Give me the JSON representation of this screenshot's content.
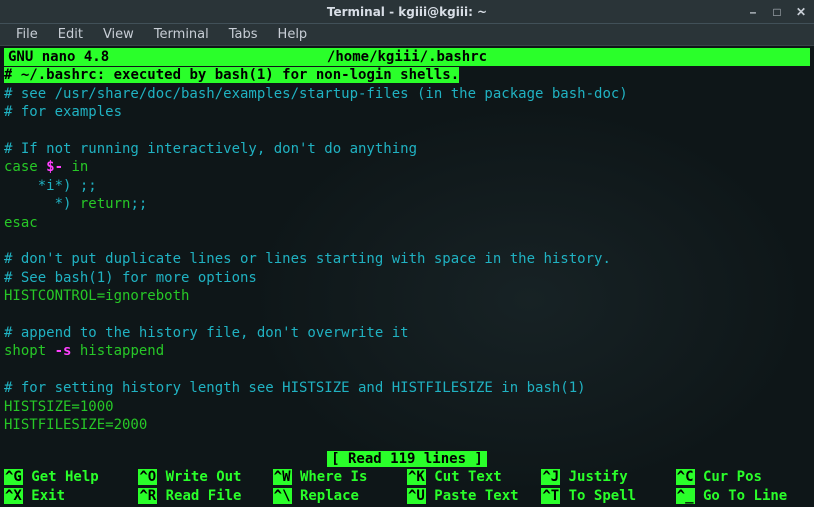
{
  "window": {
    "title": "Terminal - kgiii@kgiii: ~"
  },
  "menubar": {
    "items": [
      "File",
      "Edit",
      "View",
      "Terminal",
      "Tabs",
      "Help"
    ]
  },
  "nano": {
    "app_version": "GNU nano 4.8",
    "filepath": "/home/kgiii/.bashrc",
    "status": "[ Read 119 lines ]"
  },
  "lines": [
    {
      "segs": [
        {
          "t": "#",
          "cls": "hl"
        },
        {
          "t": " ~/.bashrc: executed by bash(1) for non-login shells.",
          "cls": "hl-text"
        }
      ]
    },
    {
      "segs": [
        {
          "t": "# see /usr/share/doc/bash/examples/startup-files (in the package bash-doc)",
          "cls": "c-cyan"
        }
      ]
    },
    {
      "segs": [
        {
          "t": "# for examples",
          "cls": "c-cyan"
        }
      ]
    },
    {
      "segs": [
        {
          "t": "",
          "cls": ""
        }
      ]
    },
    {
      "segs": [
        {
          "t": "# If not running interactively, don't do anything",
          "cls": "c-cyan"
        }
      ]
    },
    {
      "segs": [
        {
          "t": "case ",
          "cls": "c-green"
        },
        {
          "t": "$-",
          "cls": "c-magenta"
        },
        {
          "t": " in",
          "cls": "c-green"
        }
      ]
    },
    {
      "segs": [
        {
          "t": "    *i*) ;;",
          "cls": "c-cyan"
        }
      ]
    },
    {
      "segs": [
        {
          "t": "      *) ",
          "cls": "c-cyan"
        },
        {
          "t": "return",
          "cls": "c-green"
        },
        {
          "t": ";;",
          "cls": "c-cyan"
        }
      ]
    },
    {
      "segs": [
        {
          "t": "esac",
          "cls": "c-green"
        }
      ]
    },
    {
      "segs": [
        {
          "t": "",
          "cls": ""
        }
      ]
    },
    {
      "segs": [
        {
          "t": "# don't put duplicate lines or lines starting with space in the history.",
          "cls": "c-cyan"
        }
      ]
    },
    {
      "segs": [
        {
          "t": "# See bash(1) for more options",
          "cls": "c-cyan"
        }
      ]
    },
    {
      "segs": [
        {
          "t": "HISTCONTROL=ignoreboth",
          "cls": "c-green"
        }
      ]
    },
    {
      "segs": [
        {
          "t": "",
          "cls": ""
        }
      ]
    },
    {
      "segs": [
        {
          "t": "# append to the history file, don't overwrite it",
          "cls": "c-cyan"
        }
      ]
    },
    {
      "segs": [
        {
          "t": "shopt ",
          "cls": "c-green"
        },
        {
          "t": "-s",
          "cls": "c-magenta"
        },
        {
          "t": " histappend",
          "cls": "c-green"
        }
      ]
    },
    {
      "segs": [
        {
          "t": "",
          "cls": ""
        }
      ]
    },
    {
      "segs": [
        {
          "t": "# for setting history length see HISTSIZE and HISTFILESIZE in bash(1)",
          "cls": "c-cyan"
        }
      ]
    },
    {
      "segs": [
        {
          "t": "HISTSIZE=1000",
          "cls": "c-green"
        }
      ]
    },
    {
      "segs": [
        {
          "t": "HISTFILESIZE=2000",
          "cls": "c-green"
        }
      ]
    }
  ],
  "shortcuts_row1": [
    {
      "key": "^G",
      "label": "Get Help"
    },
    {
      "key": "^O",
      "label": "Write Out"
    },
    {
      "key": "^W",
      "label": "Where Is"
    },
    {
      "key": "^K",
      "label": "Cut Text"
    },
    {
      "key": "^J",
      "label": "Justify"
    },
    {
      "key": "^C",
      "label": "Cur Pos"
    }
  ],
  "shortcuts_row2": [
    {
      "key": "^X",
      "label": "Exit"
    },
    {
      "key": "^R",
      "label": "Read File"
    },
    {
      "key": "^\\",
      "label": "Replace"
    },
    {
      "key": "^U",
      "label": "Paste Text"
    },
    {
      "key": "^T",
      "label": "To Spell"
    },
    {
      "key": "^_",
      "label": "Go To Line"
    }
  ]
}
